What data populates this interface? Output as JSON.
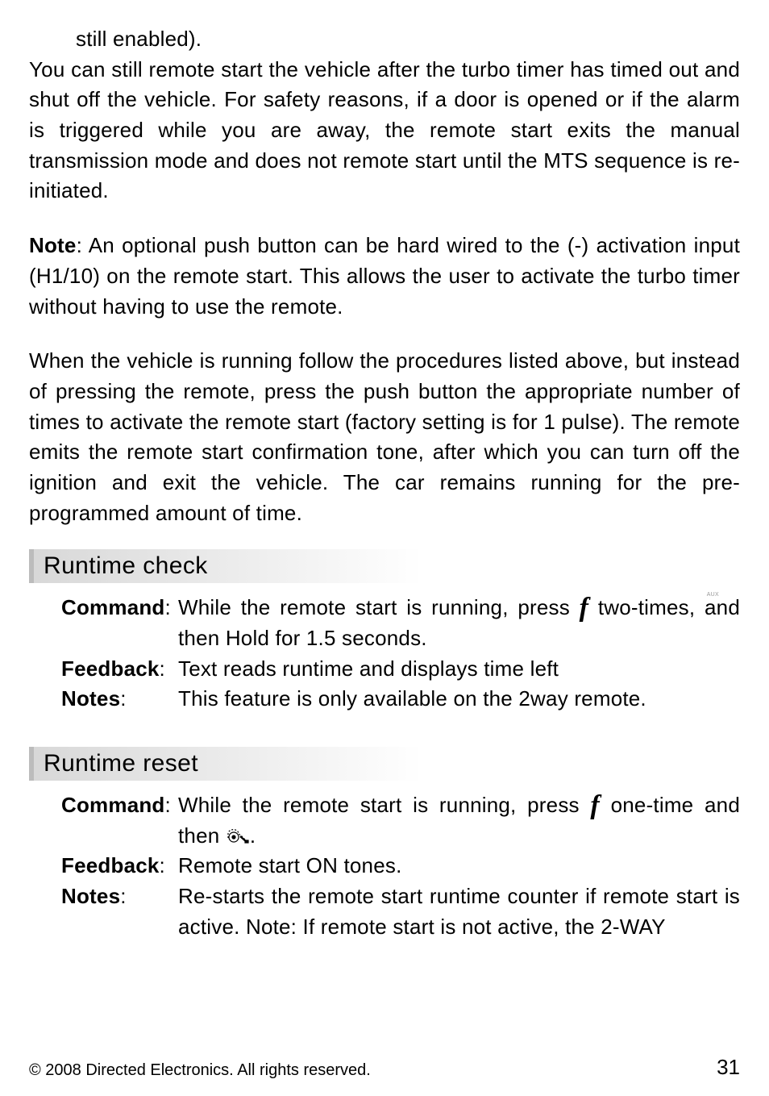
{
  "top": {
    "still_enabled": "still enabled).",
    "para1": "You can still remote start the vehicle after the turbo timer has timed out and shut off the vehicle. For safety reasons, if a door is opened or if the alarm is triggered while you are away, the remote start exits the manual transmission mode and does not remote start until the MTS sequence is re-initiated."
  },
  "note": {
    "label": "Note",
    "text": ": An optional push button can be hard wired to the (-) activation input (H1/10) on the remote start. This allows the user to activate the turbo timer without having to use the remote."
  },
  "para3": "When the vehicle is running follow the procedures listed above, but instead of pressing the remote, press the push button the appropriate number of times to activate the remote start (factory setting is for 1 pulse). The remote emits the remote start confirmation tone, after which you can turn off the ignition and exit the vehicle. The car remains running for the pre-programmed amount of time.",
  "aux_label": "AUX",
  "runtime_check": {
    "heading": "Runtime check",
    "command_label": "Command",
    "command_pre": "While the remote start is running, press ",
    "command_post": " two-times, and then Hold for 1.5 seconds.",
    "feedback_label": "Feedback",
    "feedback_text": "Text reads runtime and displays time left",
    "notes_label": "Notes",
    "notes_text": "This feature is only available on the 2way remote."
  },
  "runtime_reset": {
    "heading": "Runtime reset",
    "command_label": "Command",
    "command_pre": "While the remote start is running, press ",
    "command_mid": " one-time and then ",
    "command_post": ".",
    "feedback_label": "Feedback",
    "feedback_text": "Remote start ON tones.",
    "notes_label": "Notes",
    "notes_text": "Re-starts the remote start runtime counter if remote start is active.  Note: If remote start is not active, the 2-WAY"
  },
  "footer": {
    "copyright": "© 2008 Directed Electronics. All rights reserved.",
    "page": "31"
  }
}
